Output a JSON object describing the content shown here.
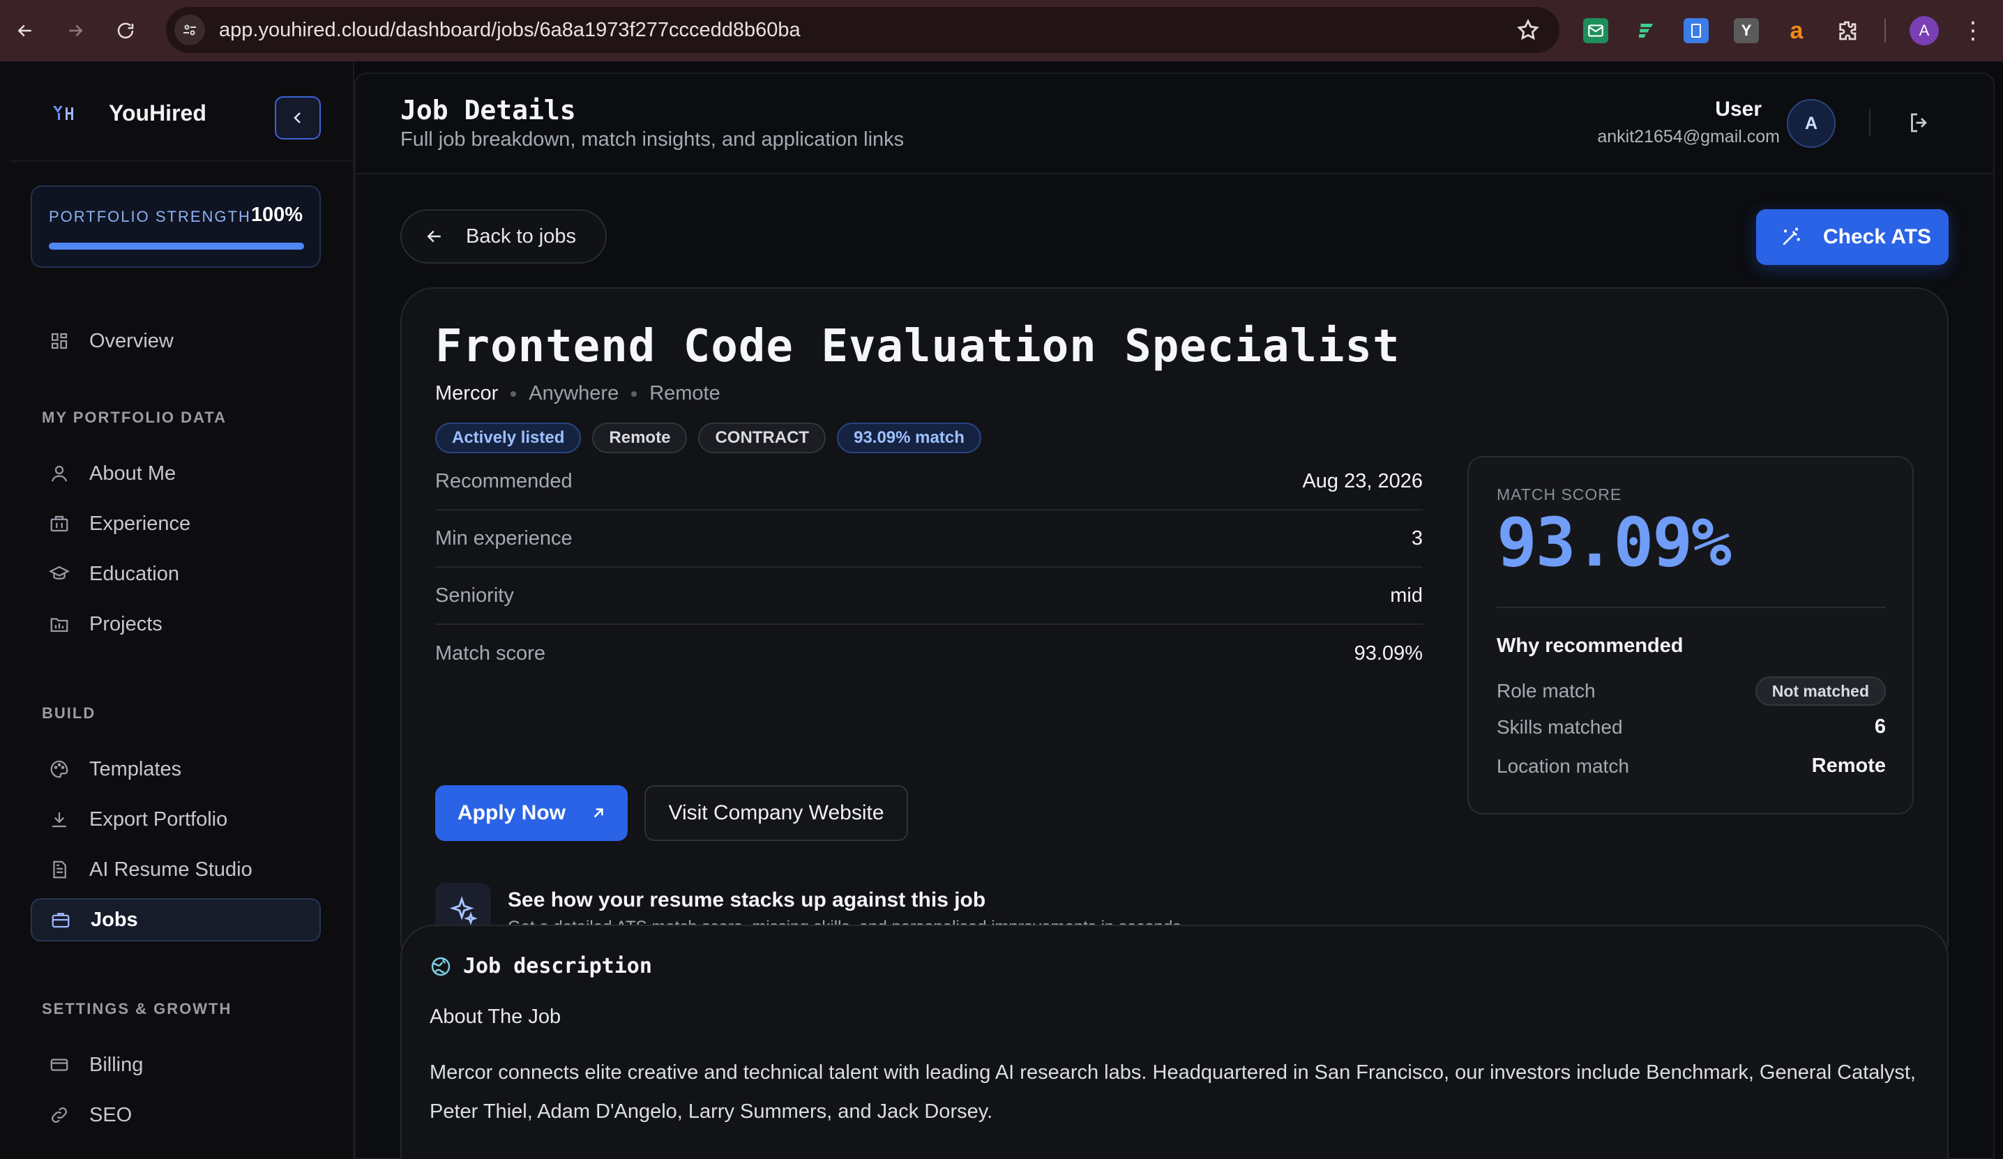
{
  "browser": {
    "url": "app.youhired.cloud/dashboard/jobs/6a8a1973f277cccedd8b60ba",
    "profile_initial": "A",
    "extensions": [
      "mail-icon",
      "flow-icon",
      "docs-icon",
      "y-icon",
      "a-icon",
      "puzzle-icon"
    ],
    "extension_letters": {
      "y": "Y",
      "a": "a"
    }
  },
  "sidebar": {
    "brand": "YouHired",
    "portfolio_strength": {
      "label": "PORTFOLIO STRENGTH",
      "value": "100%",
      "fraction": 1.0
    },
    "overview": "Overview",
    "sections": [
      {
        "title": "MY PORTFOLIO DATA",
        "items": [
          "About Me",
          "Experience",
          "Education",
          "Projects"
        ]
      },
      {
        "title": "BUILD",
        "items": [
          "Templates",
          "Export Portfolio",
          "AI Resume Studio",
          "Jobs"
        ]
      },
      {
        "title": "SETTINGS & GROWTH",
        "items": [
          "Billing",
          "SEO"
        ]
      }
    ],
    "active_item": "Jobs"
  },
  "header": {
    "title": "Job Details",
    "subtitle": "Full job breakdown, match insights, and application links",
    "user_name": "User",
    "user_email": "ankit21654@gmail.com",
    "avatar_initial": "A"
  },
  "actions": {
    "back": "Back to jobs",
    "check_ats": "Check ATS"
  },
  "job": {
    "title": "Frontend Code Evaluation Specialist",
    "company": "Mercor",
    "location": "Anywhere",
    "work_mode": "Remote",
    "tags": [
      "Actively listed",
      "Remote",
      "CONTRACT",
      "93.09% match"
    ],
    "details": [
      {
        "label": "Recommended",
        "value": "Aug 23, 2026"
      },
      {
        "label": "Min experience",
        "value": "3"
      },
      {
        "label": "Seniority",
        "value": "mid"
      },
      {
        "label": "Match score",
        "value": "93.09%"
      }
    ],
    "apply_label": "Apply Now",
    "visit_label": "Visit Company Website",
    "promo_title": "See how your resume stacks up against this job",
    "promo_subtitle": "Get a detailed ATS match score, missing skills, and personalised improvements in seconds."
  },
  "match": {
    "label": "MATCH SCORE",
    "value": "93.09%",
    "why_title": "Why recommended",
    "role_match_label": "Role match",
    "role_match_value": "Not matched",
    "skills_label": "Skills matched",
    "skills_value": "6",
    "location_label": "Location match",
    "location_value": "Remote"
  },
  "description": {
    "heading": "Job description",
    "about": "About The Job",
    "body": "Mercor connects elite creative and technical talent with leading AI research labs. Headquartered in San Francisco, our investors include Benchmark, General Catalyst, Peter Thiel, Adam D'Angelo, Larry Summers, and Jack Dorsey."
  },
  "colors": {
    "accent": "#2b63e6",
    "score": "#6f9df7",
    "chrome": "#3a2226"
  }
}
